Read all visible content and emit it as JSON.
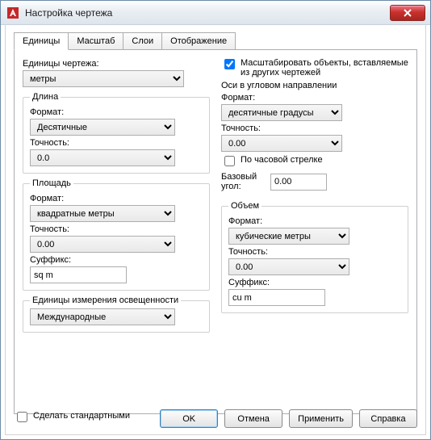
{
  "window": {
    "title": "Настройка чертежа"
  },
  "tabs": {
    "units": "Единицы",
    "scale": "Масштаб",
    "layers": "Слои",
    "display": "Отображение"
  },
  "drawing_units": {
    "label": "Единицы чертежа:",
    "value": "метры"
  },
  "chk_scale_insert": "Масштабировать объекты, вставляемые из других чертежей",
  "length": {
    "legend": "Длина",
    "format_label": "Формат:",
    "format_value": "Десятичные",
    "precision_label": "Точность:",
    "precision_value": "0.0"
  },
  "angles": {
    "heading": "Оси в угловом направлении",
    "format_label": "Формат:",
    "format_value": "десятичные градусы",
    "precision_label": "Точность:",
    "precision_value": "0.00",
    "clockwise_label": "По часовой стрелке",
    "base_angle_label": "Базовый угол:",
    "base_angle_value": "0.00"
  },
  "area": {
    "legend": "Площадь",
    "format_label": "Формат:",
    "format_value": "квадратные метры",
    "precision_label": "Точность:",
    "precision_value": "0.00",
    "suffix_label": "Суффикс:",
    "suffix_value": "sq m"
  },
  "volume": {
    "legend": "Объем",
    "format_label": "Формат:",
    "format_value": "кубические метры",
    "precision_label": "Точность:",
    "precision_value": "0.00",
    "suffix_label": "Суффикс:",
    "suffix_value": "cu m"
  },
  "lighting": {
    "legend": "Единицы измерения освещенности",
    "value": "Международные"
  },
  "footer": {
    "make_default": "Сделать стандартными",
    "ok": "OK",
    "cancel": "Отмена",
    "apply": "Применить",
    "help": "Справка"
  }
}
